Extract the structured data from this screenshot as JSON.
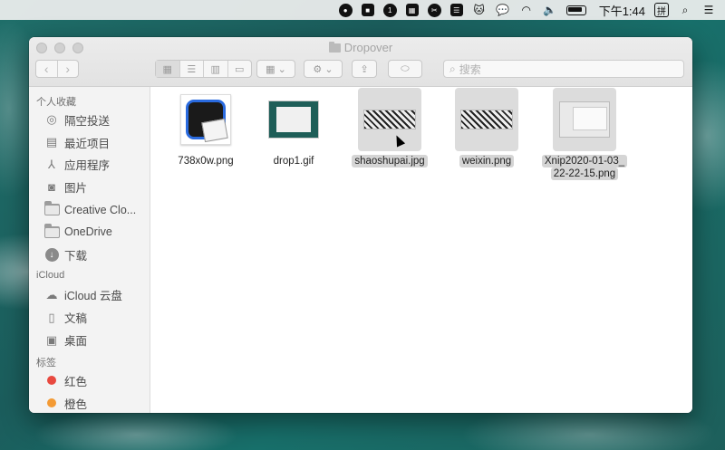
{
  "menubar": {
    "clock": "下午1:44",
    "ime": "拼",
    "status_icons": [
      "record-icon",
      "app-icon",
      "1password-icon",
      "grid-icon",
      "scissors-icon",
      "chat-icon",
      "cat-icon",
      "wechat-icon",
      "wifi-icon",
      "volume-icon",
      "battery-icon"
    ]
  },
  "window": {
    "title": "Dropover",
    "search_placeholder": "搜索"
  },
  "sidebar": {
    "sections": [
      {
        "header": "个人收藏",
        "items": [
          {
            "label": "隔空投送",
            "icon": "airdrop-icon"
          },
          {
            "label": "最近项目",
            "icon": "recents-icon"
          },
          {
            "label": "应用程序",
            "icon": "applications-icon"
          },
          {
            "label": "图片",
            "icon": "camera-icon"
          },
          {
            "label": "Creative Clo...",
            "icon": "folder-icon"
          },
          {
            "label": "OneDrive",
            "icon": "folder-icon"
          },
          {
            "label": "下载",
            "icon": "download-icon"
          }
        ]
      },
      {
        "header": "iCloud",
        "items": [
          {
            "label": "iCloud 云盘",
            "icon": "cloud-icon"
          },
          {
            "label": "文稿",
            "icon": "document-icon"
          },
          {
            "label": "桌面",
            "icon": "desktop-icon"
          }
        ]
      },
      {
        "header": "标签",
        "items": [
          {
            "label": "红色",
            "icon": "tag-dot-icon",
            "color": "#e8493f"
          },
          {
            "label": "橙色",
            "icon": "tag-dot-icon",
            "color": "#f39a34"
          }
        ]
      }
    ]
  },
  "files": [
    {
      "name": "738x0w.png",
      "selected": false
    },
    {
      "name": "drop1.gif",
      "selected": false
    },
    {
      "name": "shaoshupai.jpg",
      "selected": true
    },
    {
      "name": "weixin.png",
      "selected": true
    },
    {
      "name_line1": "Xnip2020-01-03_",
      "name_line2": "22-22-15.png",
      "selected": true
    }
  ]
}
